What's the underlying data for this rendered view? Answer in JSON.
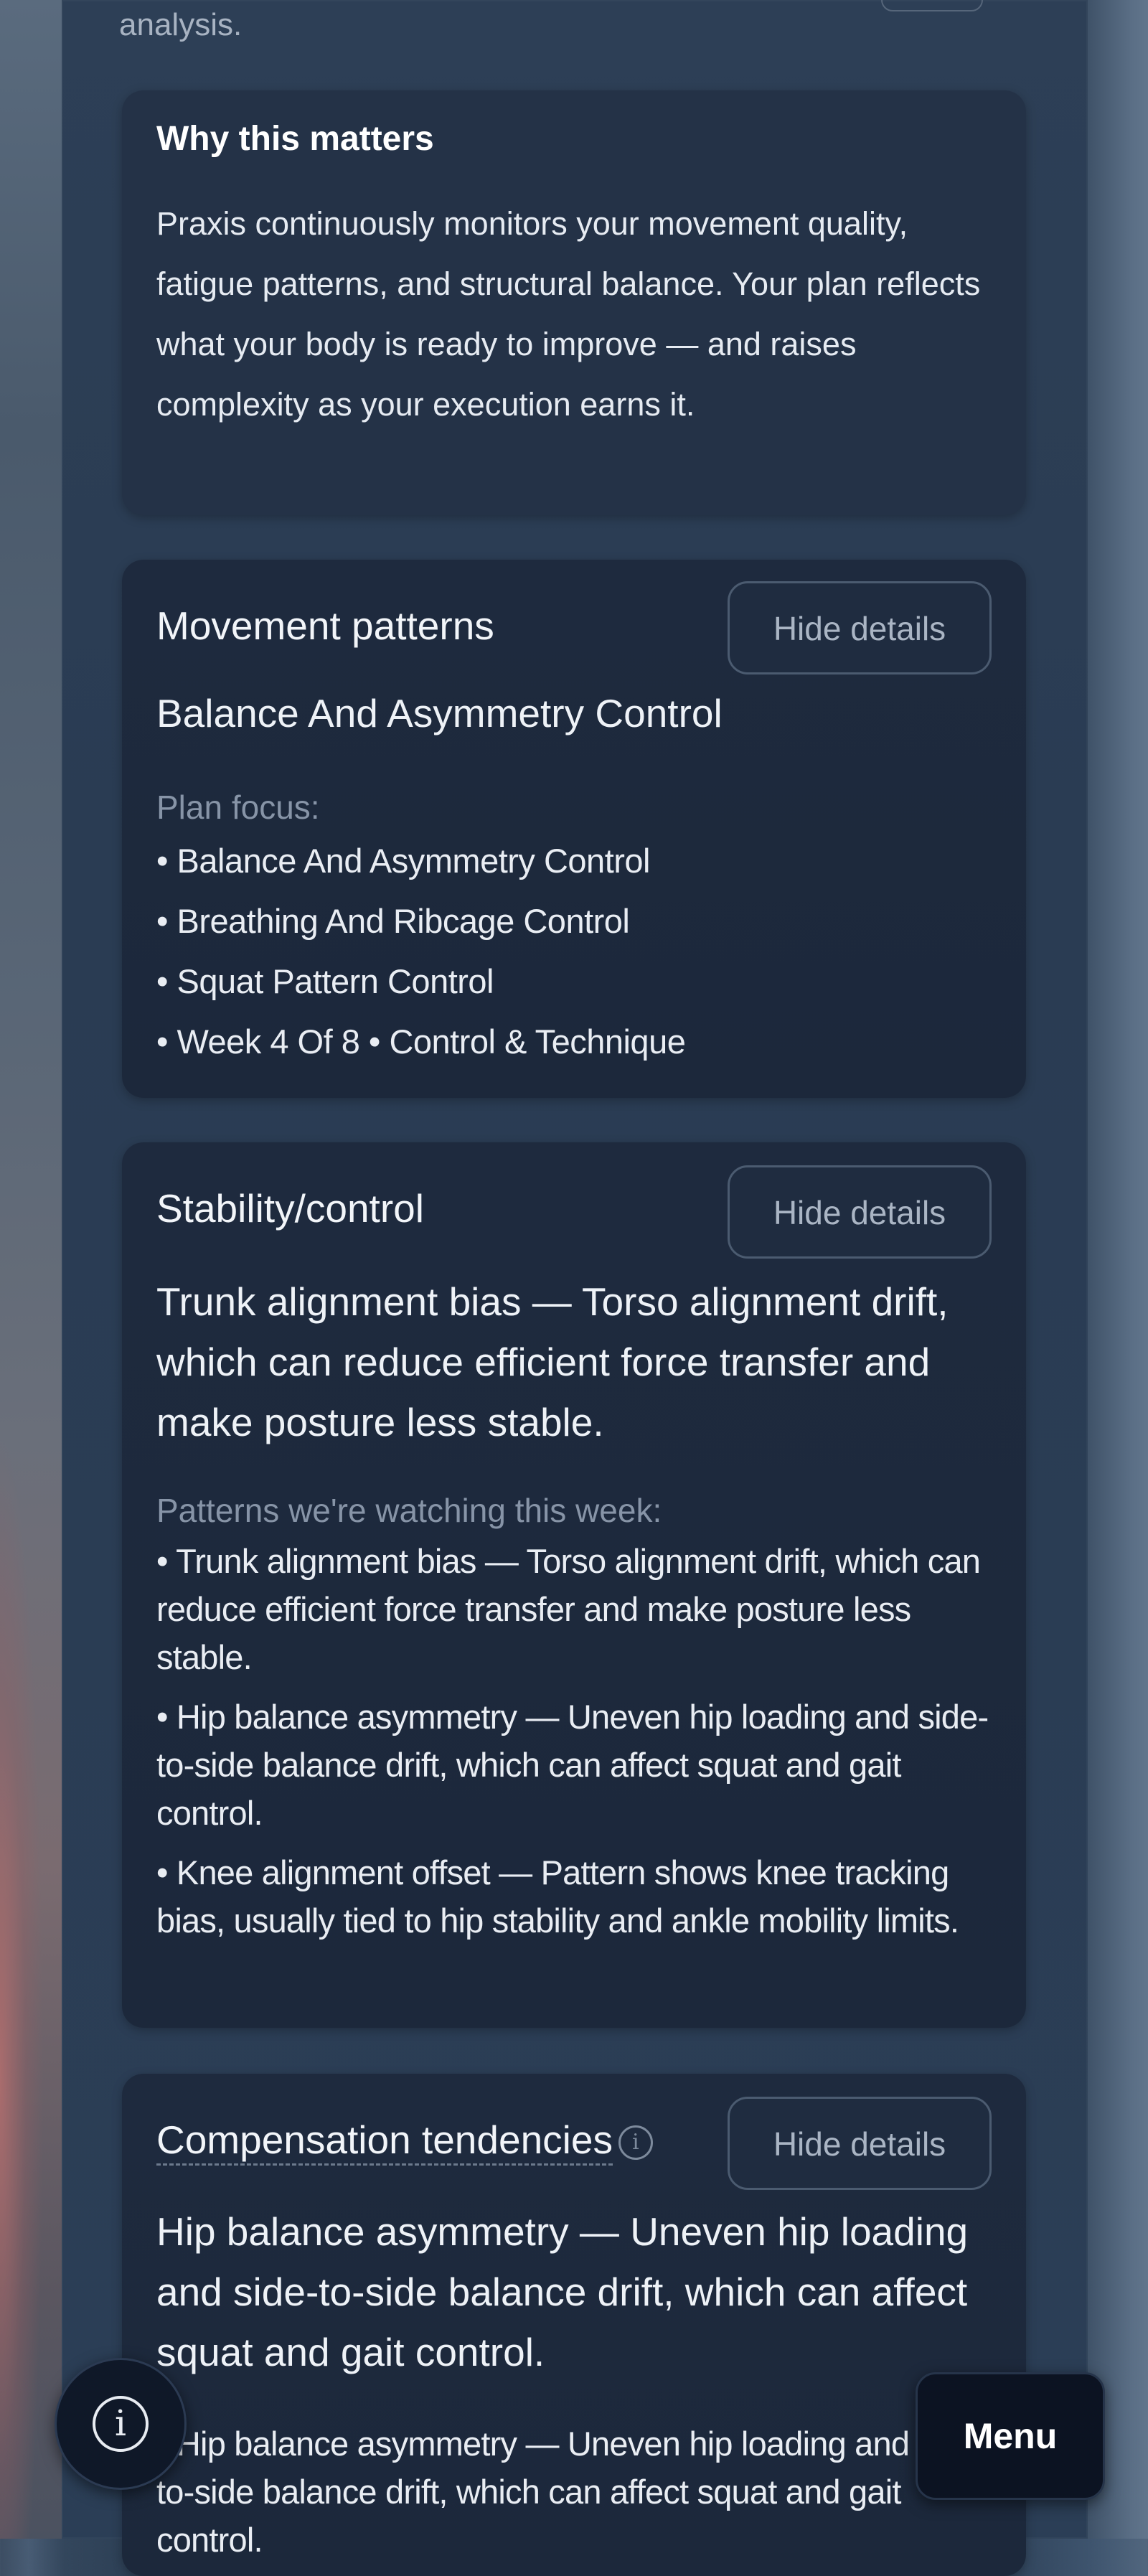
{
  "top": {
    "fragment_text": "analysis."
  },
  "why": {
    "title": "Why this matters",
    "body": "Praxis continuously monitors your movement quality, fatigue patterns, and structural balance. Your plan reflects what your body is ready to improve — and raises complexity as your execution earns it."
  },
  "movement": {
    "title": "Movement patterns",
    "hide_label": "Hide details",
    "summary": "Balance And Asymmetry Control",
    "sub_label": "Plan focus:",
    "items": [
      "• Balance And Asymmetry Control",
      "• Breathing And Ribcage Control",
      "• Squat Pattern Control",
      "• Week 4 Of 8 • Control & Technique"
    ]
  },
  "stability": {
    "title": "Stability/control",
    "hide_label": "Hide details",
    "summary": "Trunk alignment bias — Torso alignment drift, which can reduce efficient force transfer and make posture less stable.",
    "sub_label": "Patterns we're watching this week:",
    "items": [
      "• Trunk alignment bias — Torso alignment drift, which can reduce efficient force transfer and make posture less stable.",
      "• Hip balance asymmetry — Uneven hip loading and side-to-side balance drift, which can affect squat and gait control.",
      "• Knee alignment offset — Pattern shows knee tracking bias, usually tied to hip stability and ankle mobility limits."
    ]
  },
  "compensation": {
    "title": "Compensation tendencies",
    "hide_label": "Hide details",
    "summary": "Hip balance asymmetry — Uneven hip loading and side-to-side balance drift, which can affect squat and gait control.",
    "items": [
      "• Hip balance asymmetry — Uneven hip loading and side-to-side balance drift, which can affect squat and gait control."
    ]
  },
  "floating": {
    "info_glyph": "i",
    "menu_label": "Menu"
  },
  "icons": {
    "info": "info-icon"
  },
  "colors": {
    "card_bg": "#1c283b",
    "page_bg": "#2d3f56",
    "muted_text": "#8794a7",
    "button_border": "#4b5b70"
  }
}
